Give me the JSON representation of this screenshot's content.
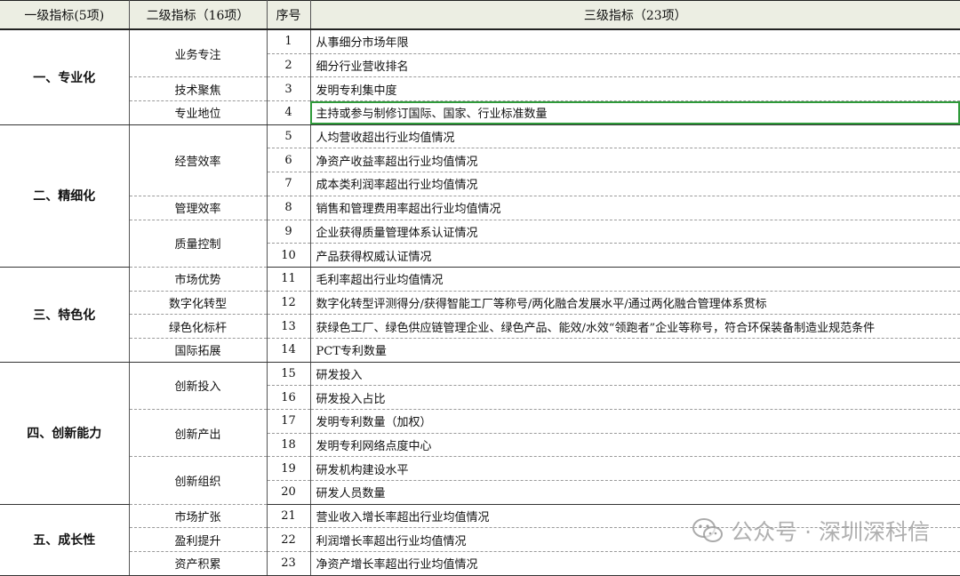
{
  "headers": {
    "level1": "一级指标(5项)",
    "level2": "二级指标（16项）",
    "number": "序号",
    "level3": "三级指标（23项）"
  },
  "groups": [
    {
      "name": "一、专业化",
      "subs": [
        {
          "name": "业务专注",
          "items": [
            {
              "no": "1",
              "text": "从事细分市场年限"
            },
            {
              "no": "2",
              "text": "细分行业营收排名"
            }
          ]
        },
        {
          "name": "技术聚焦",
          "items": [
            {
              "no": "3",
              "text": "发明专利集中度"
            }
          ]
        },
        {
          "name": "专业地位",
          "items": [
            {
              "no": "4",
              "text": "主持或参与制修订国际、国家、行业标准数量"
            }
          ]
        }
      ]
    },
    {
      "name": "二、精细化",
      "subs": [
        {
          "name": "经营效率",
          "items": [
            {
              "no": "5",
              "text": "人均营收超出行业均值情况"
            },
            {
              "no": "6",
              "text": "净资产收益率超出行业均值情况"
            },
            {
              "no": "7",
              "text": "成本类利润率超出行业均值情况"
            }
          ]
        },
        {
          "name": "管理效率",
          "items": [
            {
              "no": "8",
              "text": "销售和管理费用率超出行业均值情况"
            }
          ]
        },
        {
          "name": "质量控制",
          "items": [
            {
              "no": "9",
              "text": "企业获得质量管理体系认证情况"
            },
            {
              "no": "10",
              "text": "产品获得权威认证情况"
            }
          ]
        }
      ]
    },
    {
      "name": "三、特色化",
      "subs": [
        {
          "name": "市场优势",
          "items": [
            {
              "no": "11",
              "text": "毛利率超出行业均值情况"
            }
          ]
        },
        {
          "name": "数字化转型",
          "items": [
            {
              "no": "12",
              "text": "数字化转型评测得分/获得智能工厂等称号/两化融合发展水平/通过两化融合管理体系贯标"
            }
          ]
        },
        {
          "name": "绿色化标杆",
          "items": [
            {
              "no": "13",
              "text": "获绿色工厂、绿色供应链管理企业、绿色产品、能效/水效“领跑者”企业等称号，符合环保装备制造业规范条件"
            }
          ]
        },
        {
          "name": "国际拓展",
          "items": [
            {
              "no": "14",
              "text": "PCT专利数量"
            }
          ]
        }
      ]
    },
    {
      "name": "四、创新能力",
      "subs": [
        {
          "name": "创新投入",
          "items": [
            {
              "no": "15",
              "text": "研发投入"
            },
            {
              "no": "16",
              "text": "研发投入占比"
            }
          ]
        },
        {
          "name": "创新产出",
          "items": [
            {
              "no": "17",
              "text": "发明专利数量（加权）"
            },
            {
              "no": "18",
              "text": "发明专利网络点度中心"
            }
          ]
        },
        {
          "name": "创新组织",
          "items": [
            {
              "no": "19",
              "text": "研发机构建设水平"
            },
            {
              "no": "20",
              "text": "研发人员数量"
            }
          ]
        }
      ]
    },
    {
      "name": "五、成长性",
      "subs": [
        {
          "name": "市场扩张",
          "items": [
            {
              "no": "21",
              "text": "营业收入增长率超出行业均值情况"
            }
          ]
        },
        {
          "name": "盈利提升",
          "items": [
            {
              "no": "22",
              "text": "利润增长率超出行业均值情况"
            }
          ]
        },
        {
          "name": "资产积累",
          "items": [
            {
              "no": "23",
              "text": "净资产增长率超出行业均值情况"
            }
          ]
        }
      ]
    }
  ],
  "selected_row_no": "4",
  "watermark": {
    "text": "公众号 · 深圳深科信",
    "icon": "wechat-icon"
  },
  "colors": {
    "header_bg": "#eceee3",
    "selection": "#2f9a3a"
  }
}
